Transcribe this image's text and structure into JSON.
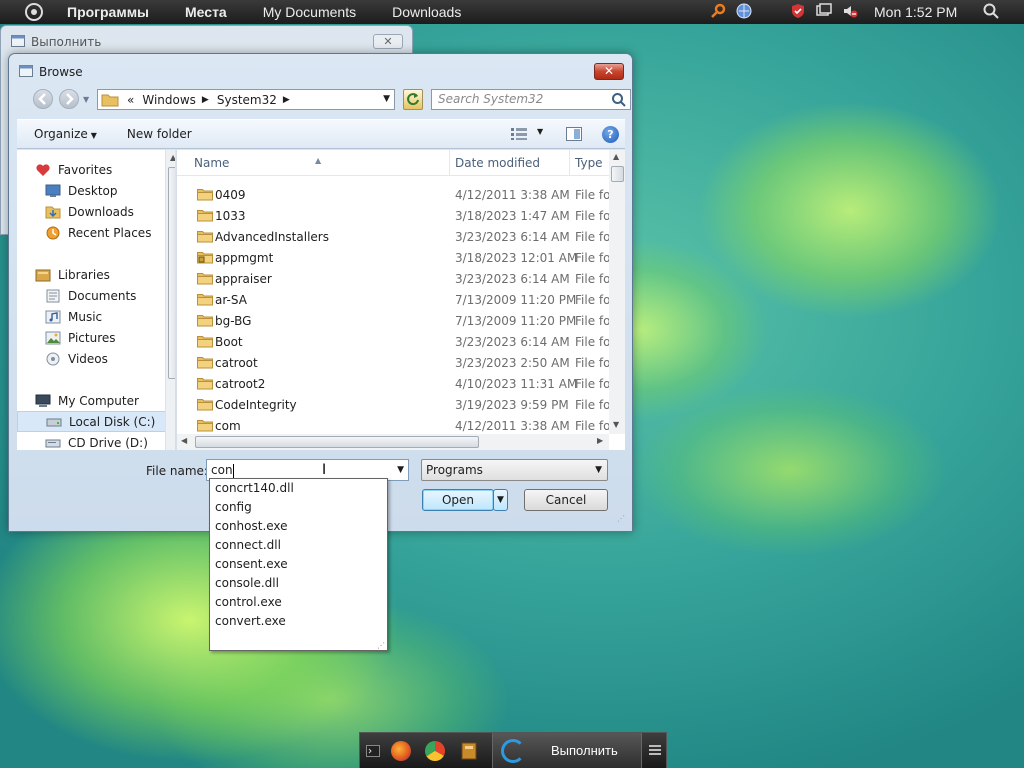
{
  "top_panel": {
    "menus": [
      "Программы",
      "Места",
      "My Documents",
      "Downloads"
    ],
    "clock": "Mon 1:52 PM"
  },
  "bg_window": {
    "title": "Выполнить"
  },
  "dialog": {
    "title": "Browse",
    "close_label": "✕",
    "address": {
      "root_glyph": "«",
      "segments": [
        "Windows",
        "System32"
      ]
    },
    "search_placeholder": "Search System32",
    "toolbar": {
      "organize": "Organize",
      "new_folder": "New folder",
      "help": "?"
    },
    "nav_pane": {
      "favorites": {
        "label": "Favorites",
        "items": [
          "Desktop",
          "Downloads",
          "Recent Places"
        ]
      },
      "libraries": {
        "label": "Libraries",
        "items": [
          "Documents",
          "Music",
          "Pictures",
          "Videos"
        ]
      },
      "computer": {
        "label": "My Computer",
        "items": [
          "Local Disk (C:)",
          "CD Drive (D:)"
        ]
      }
    },
    "columns": {
      "name": "Name",
      "date": "Date modified",
      "type": "Type"
    },
    "files": [
      {
        "name": "0409",
        "date": "4/12/2011 3:38 AM",
        "type": "File fol"
      },
      {
        "name": "1033",
        "date": "3/18/2023 1:47 AM",
        "type": "File fol"
      },
      {
        "name": "AdvancedInstallers",
        "date": "3/23/2023 6:14 AM",
        "type": "File fol"
      },
      {
        "name": "appmgmt",
        "date": "3/18/2023 12:01 AM",
        "type": "File fol"
      },
      {
        "name": "appraiser",
        "date": "3/23/2023 6:14 AM",
        "type": "File fol"
      },
      {
        "name": "ar-SA",
        "date": "7/13/2009 11:20 PM",
        "type": "File fol"
      },
      {
        "name": "bg-BG",
        "date": "7/13/2009 11:20 PM",
        "type": "File fol"
      },
      {
        "name": "Boot",
        "date": "3/23/2023 6:14 AM",
        "type": "File fol"
      },
      {
        "name": "catroot",
        "date": "3/23/2023 2:50 AM",
        "type": "File fol"
      },
      {
        "name": "catroot2",
        "date": "4/10/2023 11:31 AM",
        "type": "File fol"
      },
      {
        "name": "CodeIntegrity",
        "date": "3/19/2023 9:59 PM",
        "type": "File fol"
      },
      {
        "name": "com",
        "date": "4/12/2011 3:38 AM",
        "type": "File fol"
      }
    ],
    "file_name_label": "File name:",
    "file_name_value": "con",
    "file_type": "Programs",
    "open_label": "Open",
    "cancel_label": "Cancel",
    "autocomplete": [
      "concrt140.dll",
      "config",
      "conhost.exe",
      "connect.dll",
      "consent.exe",
      "console.dll",
      "control.exe",
      "convert.exe"
    ]
  },
  "taskbar": {
    "running_label": "Выполнить"
  },
  "colors": {
    "accent": "#3c7fb1",
    "close": "#c8452f",
    "folder": "#e8c062"
  }
}
